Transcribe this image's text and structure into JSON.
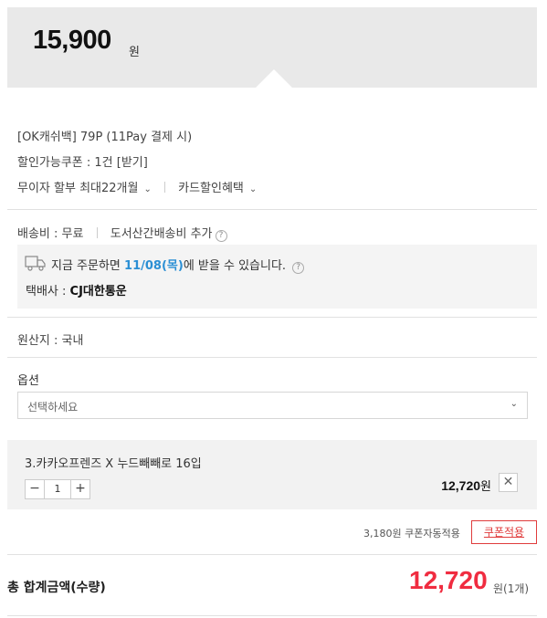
{
  "price": {
    "amount": "15,900",
    "unit": "원"
  },
  "benefits": {
    "okcashbag": "[OK캐쉬백] 79P (11Pay 결제 시)",
    "coupon": "할인가능쿠폰 : 1건 [받기]",
    "installment": "무이자 할부 최대22개월",
    "card_benefit": "카드할인혜택"
  },
  "shipping": {
    "fee": "배송비 : 무료",
    "remote": "도서산간배송비 추가",
    "eta_prefix": "지금 주문하면",
    "eta_date": "11/08(목)",
    "eta_suffix": "에 받을 수 있습니다.",
    "courier_label": "택배사 :",
    "courier_name": "CJ대한통운"
  },
  "origin": "원산지 : 국내",
  "option": {
    "label": "옵션",
    "placeholder": "선택하세요"
  },
  "selected_item": {
    "name": "3.카카오프렌즈 X 누드빼빼로 16입",
    "quantity": "1",
    "price": "12,720",
    "unit": "원",
    "minus": "−",
    "plus": "+",
    "remove": "✕"
  },
  "coupon_apply": {
    "note": "3,180원 쿠폰자동적용",
    "button": "쿠폰적용"
  },
  "total": {
    "label": "총 합계금액(수량)",
    "amount": "12,720",
    "unit": "원(1개)"
  },
  "icons": {
    "chevron_down": "⌄",
    "question": "?",
    "truck": "truck-icon"
  },
  "colors": {
    "accent_red": "#f02c40",
    "date_blue": "#2b8fd4",
    "coupon_red": "#e03c3c"
  }
}
